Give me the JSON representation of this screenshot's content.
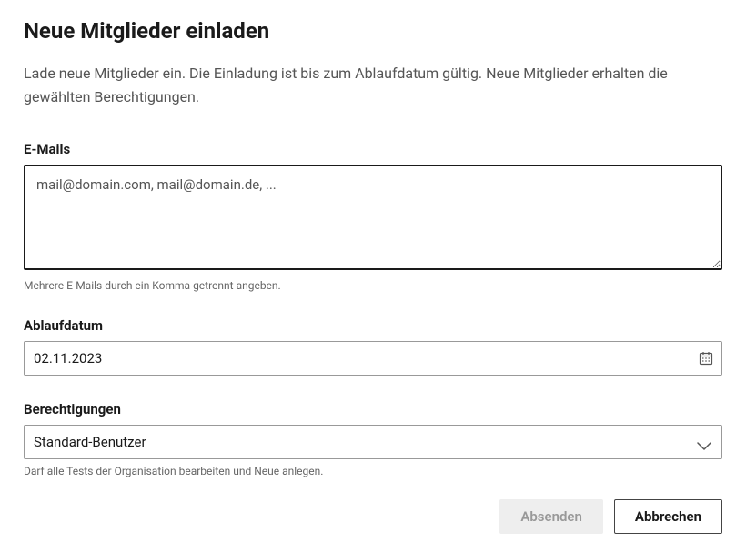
{
  "header": {
    "title": "Neue Mitglieder einladen",
    "description": "Lade neue Mitglieder ein. Die Einladung ist bis zum Ablaufdatum gültig. Neue Mitglieder erhalten die gewählten Berechtigungen."
  },
  "fields": {
    "emails": {
      "label": "E-Mails",
      "placeholder": "mail@domain.com, mail@domain.de, ...",
      "value": "",
      "help": "Mehrere E-Mails durch ein Komma getrennt angeben."
    },
    "expiration": {
      "label": "Ablaufdatum",
      "value": "02.11.2023"
    },
    "permissions": {
      "label": "Berechtigungen",
      "selected": "Standard-Benutzer",
      "help": "Darf alle Tests der Organisation bearbeiten und Neue anlegen."
    }
  },
  "buttons": {
    "submit": "Absenden",
    "cancel": "Abbrechen"
  }
}
